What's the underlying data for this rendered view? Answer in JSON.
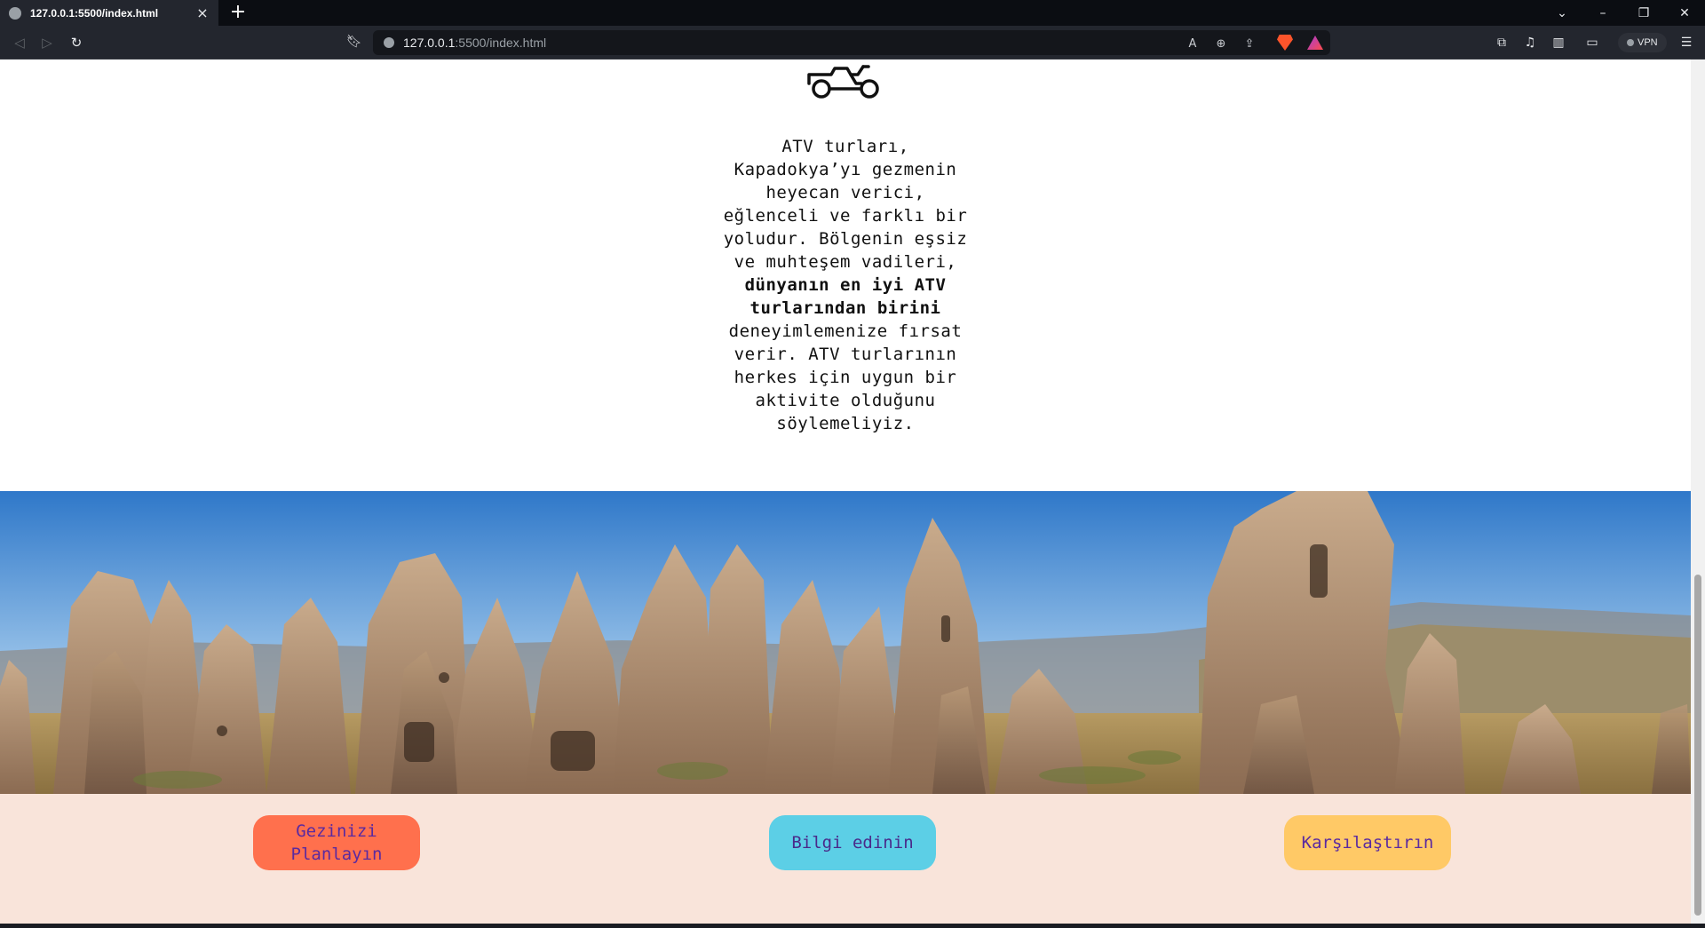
{
  "browser": {
    "tab_title": "127.0.0.1:5500/index.html",
    "url_host": "127.0.0.1",
    "url_rest": ":5500/index.html",
    "vpn_label": "VPN"
  },
  "page": {
    "intro": {
      "part1": "ATV turları, Kapadokya’yı gezmenin heyecan verici, eğlenceli ve farklı bir yoludur. Bölgenin eşsiz ve muhteşem vadileri,",
      "bold": "dünyanın en iyi ATV turlarından birini",
      "part2": "deneyimlemenize fırsat verir. ATV turlarının herkes için uygun bir aktivite olduğunu söylemeliyiz."
    },
    "stray_text": ">",
    "buttons": {
      "plan": "Gezinizi Planlayın",
      "info": "Bilgi edinin",
      "compare": "Karşılaştırın"
    },
    "colors": {
      "plan_bg": "#ff704d",
      "info_bg": "#5ccfe6",
      "compare_bg": "#ffc966",
      "band_bg": "#f9e4da"
    },
    "icons": [
      "atv-icon",
      "hero-image-cappadocia"
    ]
  }
}
